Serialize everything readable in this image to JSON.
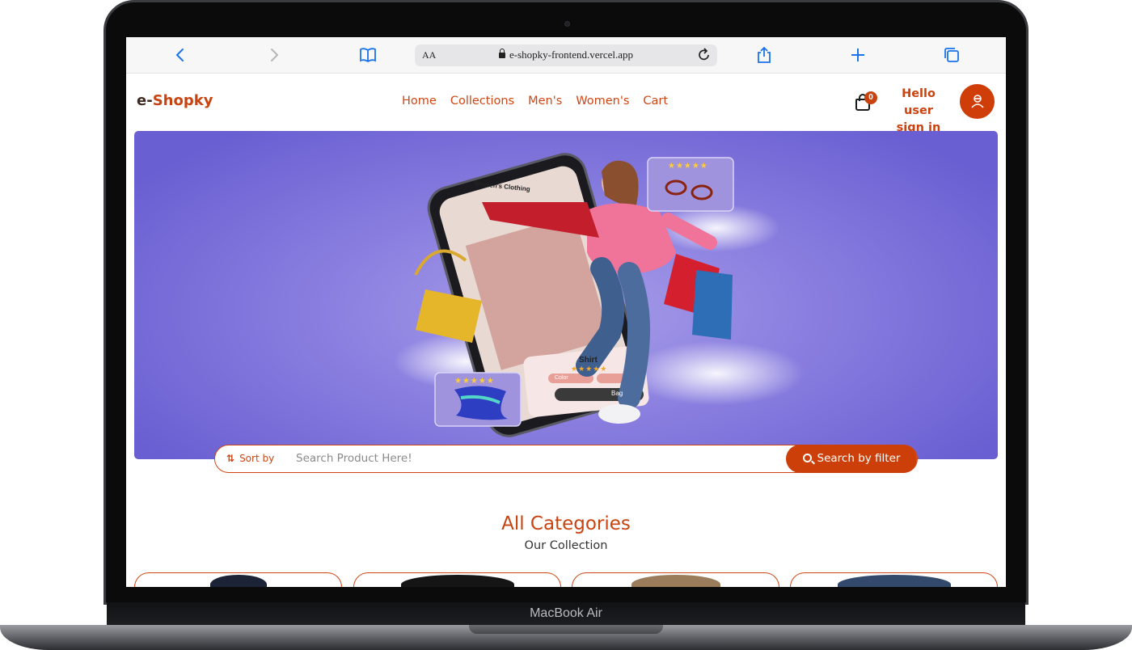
{
  "device": {
    "label": "MacBook Air"
  },
  "browser": {
    "text_size_label": "AA",
    "url": "e-shopky-frontend.vercel.app"
  },
  "site": {
    "logo": {
      "prefix": "e-",
      "name": "Shopky"
    },
    "nav": [
      {
        "label": "Home"
      },
      {
        "label": "Collections"
      },
      {
        "label": "Men's"
      },
      {
        "label": "Women's"
      },
      {
        "label": "Cart"
      }
    ],
    "cart_count": "0",
    "user": {
      "greeting": "Hello user",
      "action": "sign in"
    }
  },
  "hero": {
    "phone_heading": "Women's Clothing",
    "product_name": "Shirt",
    "color_option": "Color",
    "bag_button": "Bag",
    "rating_stars": "★★★★★"
  },
  "search": {
    "sort_label": "Sort by",
    "placeholder": "Search Product Here!",
    "button_label": "Search by filter"
  },
  "categories": {
    "title": "All Categories",
    "subtitle": "Our Collection"
  },
  "colors": {
    "accent": "#cf4513",
    "hero_bg": "#8b80e0"
  }
}
